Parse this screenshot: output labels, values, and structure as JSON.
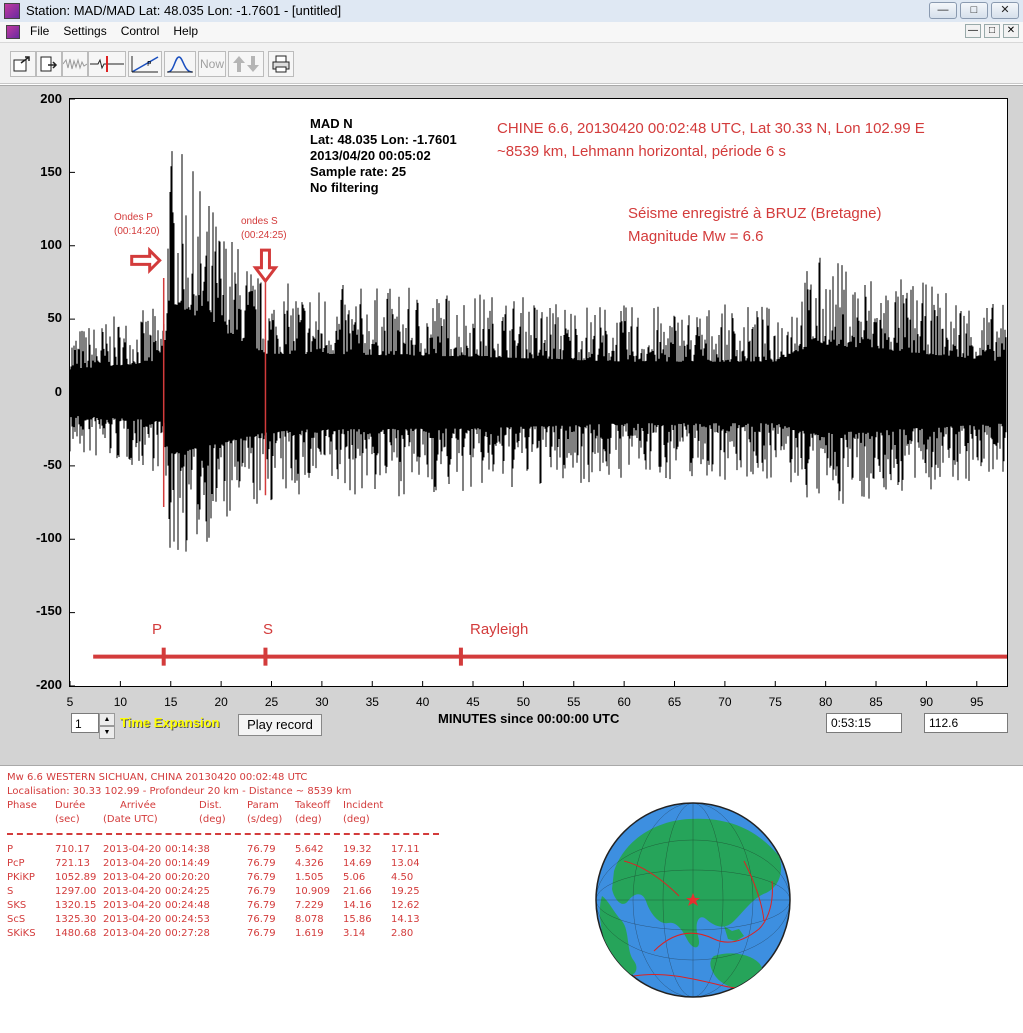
{
  "window": {
    "title": "Station: MAD/MAD Lat: 48.035 Lon: -1.7601 - [untitled]",
    "min_symbol": "—",
    "max_symbol": "□",
    "close_symbol": "✕"
  },
  "menu": {
    "items": [
      "File",
      "Settings",
      "Control",
      "Help"
    ]
  },
  "toolbar": {
    "now_label": "Now"
  },
  "plot": {
    "station_lines": [
      "MAD  N",
      "Lat: 48.035 Lon: -1.7601",
      "2013/04/20 00:05:02",
      "Sample rate: 25",
      "No filtering"
    ],
    "event_line1": "CHINE 6.6, 20130420 00:02:48 UTC, Lat 30.33 N, Lon 102.99 E",
    "event_line2": "~8539 km, Lehmann horizontal, période 6 s",
    "note_line1": "Séisme enregistré à BRUZ (Bretagne)",
    "note_line2": "Magnitude Mw = 6.6",
    "p_annot": [
      "Ondes P",
      "(00:14:20)"
    ],
    "s_annot": [
      "ondes S",
      "(00:24:25)"
    ],
    "phase_labels": {
      "p": "P",
      "s": "S",
      "rayleigh": "Rayleigh"
    },
    "colors": {
      "trace": "#000000",
      "annotation": "#d33b3b"
    }
  },
  "chart_data": {
    "type": "line",
    "title": "",
    "xlabel": "MINUTES since 00:00:00 UTC",
    "ylabel": "",
    "xlim": [
      5,
      98
    ],
    "ylim": [
      -200,
      200
    ],
    "x_ticks": [
      5,
      10,
      15,
      20,
      25,
      30,
      35,
      40,
      45,
      50,
      55,
      60,
      65,
      70,
      75,
      80,
      85,
      90,
      95
    ],
    "y_ticks": [
      200,
      150,
      100,
      50,
      0,
      -50,
      -100,
      -150,
      -200
    ],
    "series": [
      {
        "x": [
          5,
          14.3,
          14.8,
          24.4,
          28,
          45,
          60,
          75,
          79,
          98
        ],
        "y_max": [
          45,
          60,
          178,
          75,
          75,
          70,
          60,
          60,
          95,
          60
        ],
        "y_min": [
          -45,
          -55,
          -120,
          -78,
          -72,
          -70,
          -60,
          -60,
          -80,
          -60
        ]
      }
    ],
    "markers": [
      {
        "label": "P",
        "x": 14.3
      },
      {
        "label": "S",
        "x": 24.4
      },
      {
        "label": "Rayleigh",
        "x": 43.8
      }
    ]
  },
  "controls": {
    "expansion_value": "1",
    "spin_up": "▲",
    "spin_down": "▼",
    "time_expansion_label": "Time Expansion",
    "play_label": "Play record",
    "time_value": "0:53:15",
    "value2": "112.6"
  },
  "report": {
    "line1": "Mw 6.6  WESTERN SICHUAN, CHINA 20130420 00:02:48 UTC",
    "line2": "Localisation: 30.33 102.99 - Profondeur 20  km - Distance ~ 8539 km",
    "headers": [
      "Phase",
      "Durée",
      "Arrivée",
      "Dist.",
      "Param",
      "Takeoff",
      "Incident"
    ],
    "subheaders": [
      "(sec)",
      "(Date UTC)",
      "(deg)",
      "(s/deg)",
      "(deg)",
      "(deg)"
    ],
    "rows": [
      [
        "P",
        "710.17",
        "2013-04-20",
        "00:14:38",
        "76.79",
        "5.642",
        "19.32",
        "17.11"
      ],
      [
        "PcP",
        "721.13",
        "2013-04-20",
        "00:14:49",
        "76.79",
        "4.326",
        "14.69",
        "13.04"
      ],
      [
        "PKiKP",
        "1052.89",
        "2013-04-20",
        "00:20:20",
        "76.79",
        "1.505",
        "5.06",
        "4.50"
      ],
      [
        "S",
        "1297.00",
        "2013-04-20",
        "00:24:25",
        "76.79",
        "10.909",
        "21.66",
        "19.25"
      ],
      [
        "SKS",
        "1320.15",
        "2013-04-20",
        "00:24:48",
        "76.79",
        "7.229",
        "14.16",
        "12.62"
      ],
      [
        "ScS",
        "1325.30",
        "2013-04-20",
        "00:24:53",
        "76.79",
        "8.078",
        "15.86",
        "14.13"
      ],
      [
        "SKiKS",
        "1480.68",
        "2013-04-20",
        "00:27:28",
        "76.79",
        "1.619",
        "3.14",
        "2.80"
      ]
    ]
  }
}
